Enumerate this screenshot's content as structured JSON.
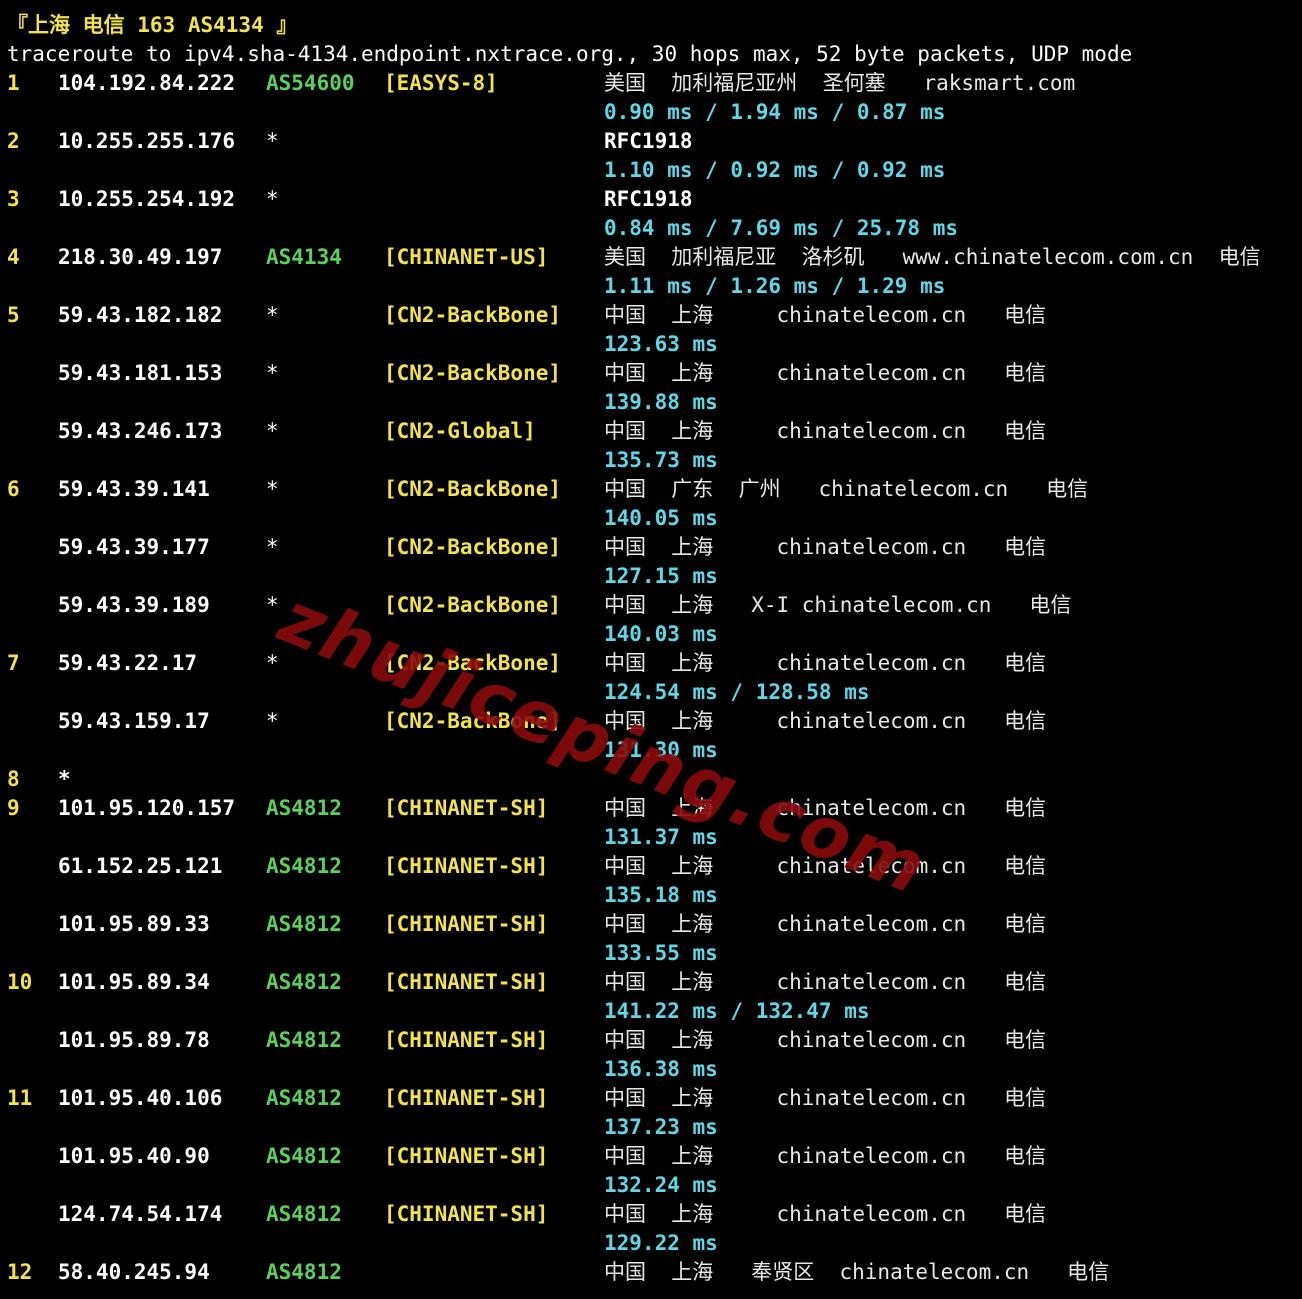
{
  "header": "『上海 电信 163 AS4134 』",
  "trace_line": "traceroute to ipv4.sha-4134.endpoint.nxtrace.org., 30 hops max, 52 byte packets, UDP mode",
  "watermark": "zhujiceping.com",
  "rows": [
    {
      "hop": "1",
      "ip": "104.192.84.222",
      "asn": "AS54600",
      "tag": "[EASYS-8]",
      "geo": "美国  加利福尼亚州  圣何塞   raksmart.com",
      "rtt": "0.90 ms / 1.94 ms / 0.87 ms"
    },
    {
      "hop": "2",
      "ip": "10.255.255.176",
      "asn": "*",
      "tag": "",
      "geo": "RFC1918",
      "rtt": "1.10 ms / 0.92 ms / 0.92 ms"
    },
    {
      "hop": "3",
      "ip": "10.255.254.192",
      "asn": "*",
      "tag": "",
      "geo": "RFC1918",
      "rtt": "0.84 ms / 7.69 ms / 25.78 ms"
    },
    {
      "hop": "4",
      "ip": "218.30.49.197",
      "asn": "AS4134",
      "tag": "[CHINANET-US]",
      "geo": "美国  加利福尼亚  洛杉矶   www.chinatelecom.com.cn  电信",
      "rtt": "1.11 ms / 1.26 ms / 1.29 ms"
    },
    {
      "hop": "5",
      "ip": "59.43.182.182",
      "asn": "*",
      "tag": "[CN2-BackBone]",
      "geo": "中国  上海     chinatelecom.cn   电信",
      "rtt": "123.63 ms"
    },
    {
      "hop": "",
      "ip": "59.43.181.153",
      "asn": "*",
      "tag": "[CN2-BackBone]",
      "geo": "中国  上海     chinatelecom.cn   电信",
      "rtt": "139.88 ms"
    },
    {
      "hop": "",
      "ip": "59.43.246.173",
      "asn": "*",
      "tag": "[CN2-Global]",
      "geo": "中国  上海     chinatelecom.cn   电信",
      "rtt": "135.73 ms"
    },
    {
      "hop": "6",
      "ip": "59.43.39.141",
      "asn": "*",
      "tag": "[CN2-BackBone]",
      "geo": "中国  广东  广州   chinatelecom.cn   电信",
      "rtt": "140.05 ms"
    },
    {
      "hop": "",
      "ip": "59.43.39.177",
      "asn": "*",
      "tag": "[CN2-BackBone]",
      "geo": "中国  上海     chinatelecom.cn   电信",
      "rtt": "127.15 ms"
    },
    {
      "hop": "",
      "ip": "59.43.39.189",
      "asn": "*",
      "tag": "[CN2-BackBone]",
      "geo": "中国  上海   X-I chinatelecom.cn   电信",
      "rtt": "140.03 ms"
    },
    {
      "hop": "7",
      "ip": "59.43.22.17",
      "asn": "*",
      "tag": "[CN2-BackBone]",
      "geo": "中国  上海     chinatelecom.cn   电信",
      "rtt": "124.54 ms / 128.58 ms"
    },
    {
      "hop": "",
      "ip": "59.43.159.17",
      "asn": "*",
      "tag": "[CN2-BackBone]",
      "geo": "中国  上海     chinatelecom.cn   电信",
      "rtt": "131.30 ms"
    },
    {
      "hop": "8",
      "ip": "*",
      "asn": "",
      "tag": "",
      "geo": "",
      "rtt": ""
    },
    {
      "hop": "9",
      "ip": "101.95.120.157",
      "asn": "AS4812",
      "tag": "[CHINANET-SH]",
      "geo": "中国  上海     chinatelecom.cn   电信",
      "rtt": "131.37 ms"
    },
    {
      "hop": "",
      "ip": "61.152.25.121",
      "asn": "AS4812",
      "tag": "[CHINANET-SH]",
      "geo": "中国  上海     chinatelecom.cn   电信",
      "rtt": "135.18 ms"
    },
    {
      "hop": "",
      "ip": "101.95.89.33",
      "asn": "AS4812",
      "tag": "[CHINANET-SH]",
      "geo": "中国  上海     chinatelecom.cn   电信",
      "rtt": "133.55 ms"
    },
    {
      "hop": "10",
      "ip": "101.95.89.34",
      "asn": "AS4812",
      "tag": "[CHINANET-SH]",
      "geo": "中国  上海     chinatelecom.cn   电信",
      "rtt": "141.22 ms / 132.47 ms"
    },
    {
      "hop": "",
      "ip": "101.95.89.78",
      "asn": "AS4812",
      "tag": "[CHINANET-SH]",
      "geo": "中国  上海     chinatelecom.cn   电信",
      "rtt": "136.38 ms"
    },
    {
      "hop": "11",
      "ip": "101.95.40.106",
      "asn": "AS4812",
      "tag": "[CHINANET-SH]",
      "geo": "中国  上海     chinatelecom.cn   电信",
      "rtt": "137.23 ms"
    },
    {
      "hop": "",
      "ip": "101.95.40.90",
      "asn": "AS4812",
      "tag": "[CHINANET-SH]",
      "geo": "中国  上海     chinatelecom.cn   电信",
      "rtt": "132.24 ms"
    },
    {
      "hop": "",
      "ip": "124.74.54.174",
      "asn": "AS4812",
      "tag": "[CHINANET-SH]",
      "geo": "中国  上海     chinatelecom.cn   电信",
      "rtt": "129.22 ms"
    },
    {
      "hop": "12",
      "ip": "58.40.245.94",
      "asn": "AS4812",
      "tag": "",
      "geo": "中国  上海   奉贤区  chinatelecom.cn   电信",
      "rtt": ""
    }
  ]
}
